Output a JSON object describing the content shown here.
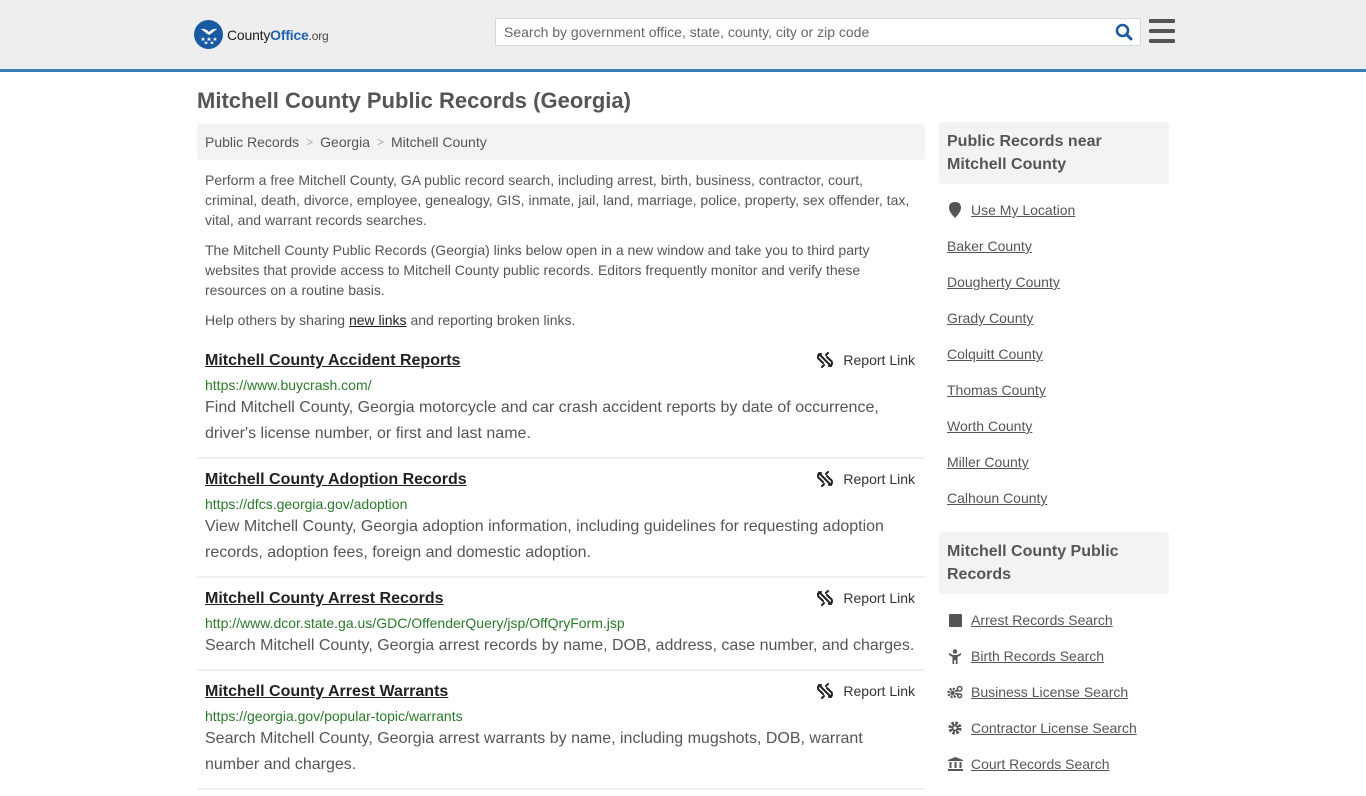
{
  "header": {
    "logo": {
      "county": "County",
      "office": "Office",
      "org": ".org"
    },
    "search_placeholder": "Search by government office, state, county, city or zip code",
    "search_value": ""
  },
  "page_title": "Mitchell County Public Records (Georgia)",
  "breadcrumb": [
    "Public Records",
    "Georgia",
    "Mitchell County"
  ],
  "intro": {
    "p1": "Perform a free Mitchell County, GA public record search, including arrest, birth, business, contractor, court, criminal, death, divorce, employee, genealogy, GIS, inmate, jail, land, marriage, police, property, sex offender, tax, vital, and warrant records searches.",
    "p2": "The Mitchell County Public Records (Georgia) links below open in a new window and take you to third party websites that provide access to Mitchell County public records. Editors frequently monitor and verify these resources on a routine basis.",
    "p3_before": "Help others by sharing ",
    "p3_link": "new links",
    "p3_after": " and reporting broken links."
  },
  "report_label": "Report Link",
  "records": [
    {
      "title": "Mitchell County Accident Reports",
      "url": "https://www.buycrash.com/",
      "desc": "Find Mitchell County, Georgia motorcycle and car crash accident reports by date of occurrence, driver's license number, or first and last name."
    },
    {
      "title": "Mitchell County Adoption Records",
      "url": "https://dfcs.georgia.gov/adoption",
      "desc": "View Mitchell County, Georgia adoption information, including guidelines for requesting adoption records, adoption fees, foreign and domestic adoption."
    },
    {
      "title": "Mitchell County Arrest Records",
      "url": "http://www.dcor.state.ga.us/GDC/OffenderQuery/jsp/OffQryForm.jsp",
      "desc": "Search Mitchell County, Georgia arrest records by name, DOB, address, case number, and charges."
    },
    {
      "title": "Mitchell County Arrest Warrants",
      "url": "https://georgia.gov/popular-topic/warrants",
      "desc": "Search Mitchell County, Georgia arrest warrants by name, including mugshots, DOB, warrant number and charges."
    }
  ],
  "sidebar": {
    "near": {
      "heading": "Public Records near Mitchell County",
      "use_location": "Use My Location",
      "counties": [
        "Baker County",
        "Dougherty County",
        "Grady County",
        "Colquitt County",
        "Thomas County",
        "Worth County",
        "Miller County",
        "Calhoun County"
      ]
    },
    "records": {
      "heading": "Mitchell County Public Records",
      "items": [
        {
          "label": "Arrest Records Search",
          "icon": "square-icon"
        },
        {
          "label": "Birth Records Search",
          "icon": "child-icon"
        },
        {
          "label": "Business License Search",
          "icon": "gears-icon"
        },
        {
          "label": "Contractor License Search",
          "icon": "gear-icon"
        },
        {
          "label": "Court Records Search",
          "icon": "courthouse-icon"
        }
      ]
    }
  },
  "colors": {
    "brand_blue": "#1a5aa3",
    "header_border": "#3a7fb4",
    "url_green": "#2a7a2a"
  }
}
